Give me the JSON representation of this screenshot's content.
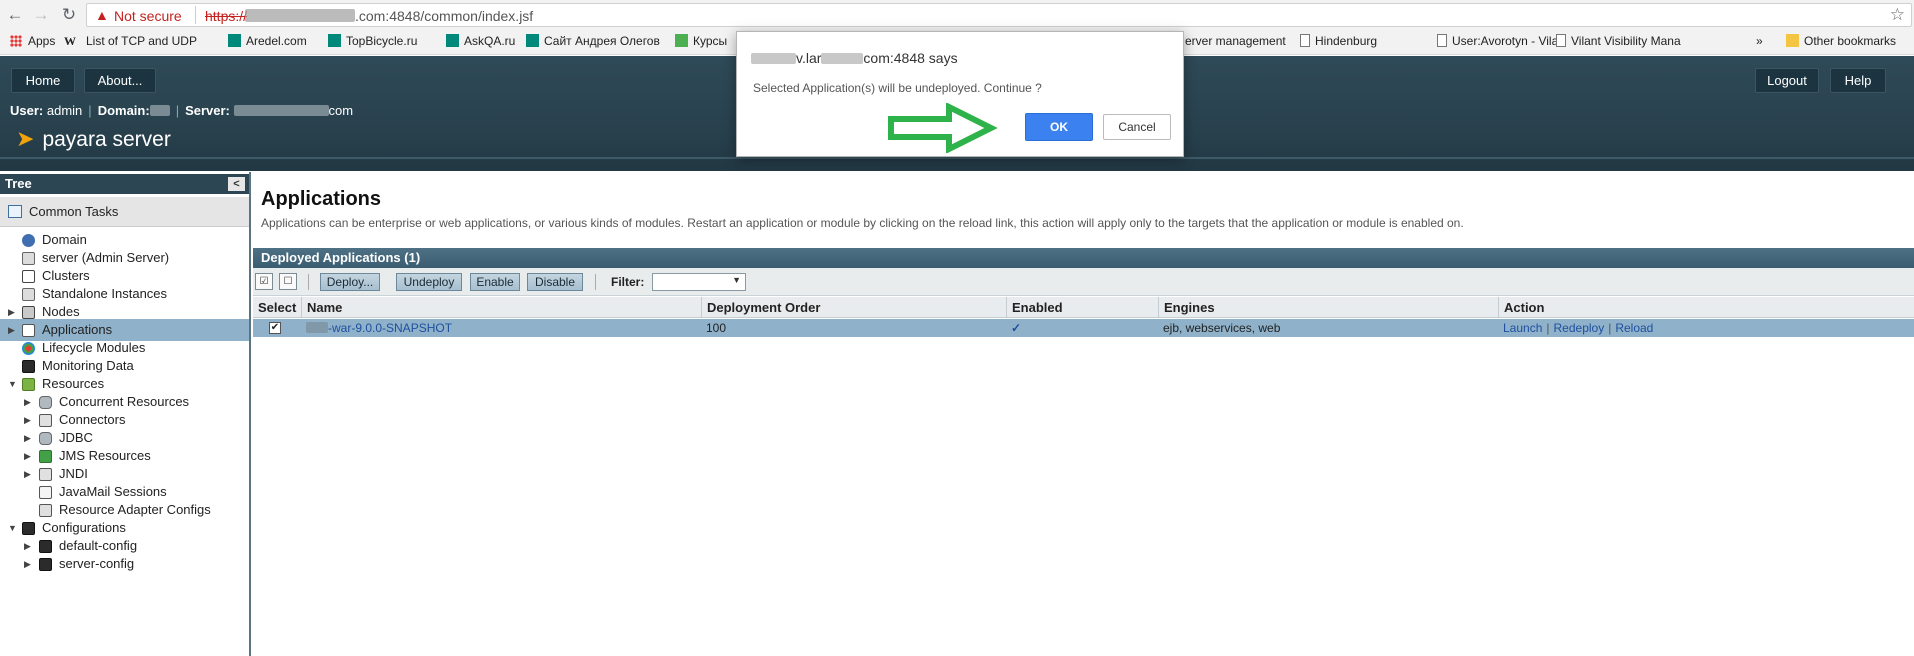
{
  "browser": {
    "security_label": "Not secure",
    "url_protocol": "https://",
    "url_rest": ".com:4848/common/index.jsf",
    "bookmarks": [
      {
        "label": "Apps"
      },
      {
        "label": "W"
      },
      {
        "label": "List of TCP and UDP"
      },
      {
        "label": "Aredel.com"
      },
      {
        "label": "TopBicycle.ru"
      },
      {
        "label": "AskQA.ru"
      },
      {
        "label": "Сайт Андрея Олегов"
      },
      {
        "label": "Курсы"
      },
      {
        "label": "erver management"
      },
      {
        "label": "Hindenburg"
      },
      {
        "label": "User:Avorotyn - Vilan"
      },
      {
        "label": "Vilant Visibility Mana"
      },
      {
        "label": "»"
      },
      {
        "label": "Other bookmarks"
      }
    ]
  },
  "header": {
    "buttons": {
      "home": "Home",
      "about": "About...",
      "logout": "Logout",
      "help": "Help"
    },
    "user_label": "User:",
    "user_value": "admin",
    "domain_label": "Domain:",
    "server_label": "Server:",
    "server_suffix": "com",
    "logo_text": "payara server"
  },
  "sidebar": {
    "title": "Tree",
    "collapse_glyph": "<",
    "common_tasks": "Common Tasks",
    "items": [
      {
        "label": "Domain"
      },
      {
        "label": "server (Admin Server)"
      },
      {
        "label": "Clusters"
      },
      {
        "label": "Standalone Instances"
      },
      {
        "label": "Nodes"
      },
      {
        "label": "Applications"
      },
      {
        "label": "Lifecycle Modules"
      },
      {
        "label": "Monitoring Data"
      },
      {
        "label": "Resources"
      },
      {
        "label": "Concurrent Resources"
      },
      {
        "label": "Connectors"
      },
      {
        "label": "JDBC"
      },
      {
        "label": "JMS Resources"
      },
      {
        "label": "JNDI"
      },
      {
        "label": "JavaMail Sessions"
      },
      {
        "label": "Resource Adapter Configs"
      },
      {
        "label": "Configurations"
      },
      {
        "label": "default-config"
      },
      {
        "label": "server-config"
      }
    ],
    "selected": "Applications"
  },
  "main": {
    "title": "Applications",
    "description": "Applications can be enterprise or web applications, or various kinds of modules. Restart an application or module by clicking on the reload link, this action will apply only to the targets that the application or module is enabled on.",
    "table_title": "Deployed Applications (1)",
    "toolbar": {
      "deploy": "Deploy...",
      "undeploy": "Undeploy",
      "enable": "Enable",
      "disable": "Disable",
      "filter_label": "Filter:",
      "filter_value": ""
    },
    "columns": [
      "Select",
      "Name",
      "Deployment Order",
      "Enabled",
      "Engines",
      "Action"
    ],
    "rows": [
      {
        "selected": true,
        "name": "-war-9.0.0-SNAPSHOT",
        "deployment_order": "100",
        "enabled": true,
        "engines": "ejb, webservices, web",
        "actions": [
          "Launch",
          "Redeploy",
          "Reload"
        ]
      }
    ]
  },
  "dialog": {
    "title_host_part": "v.lar",
    "title_suffix": "com:4848 says",
    "message": "Selected Application(s) will be undeployed. Continue ?",
    "ok_label": "OK",
    "cancel_label": "Cancel"
  },
  "colors": {
    "masthead": "#2f4a58",
    "selection": "#8fb2ca",
    "ok_button": "#3b82f0",
    "annotation_arrow": "#2db34a",
    "warning": "#c5221f"
  },
  "icons": {
    "back": "arrow-left-icon",
    "forward": "arrow-right-icon",
    "reload": "reload-icon",
    "warning": "warning-triangle-icon",
    "star": "star-icon"
  }
}
